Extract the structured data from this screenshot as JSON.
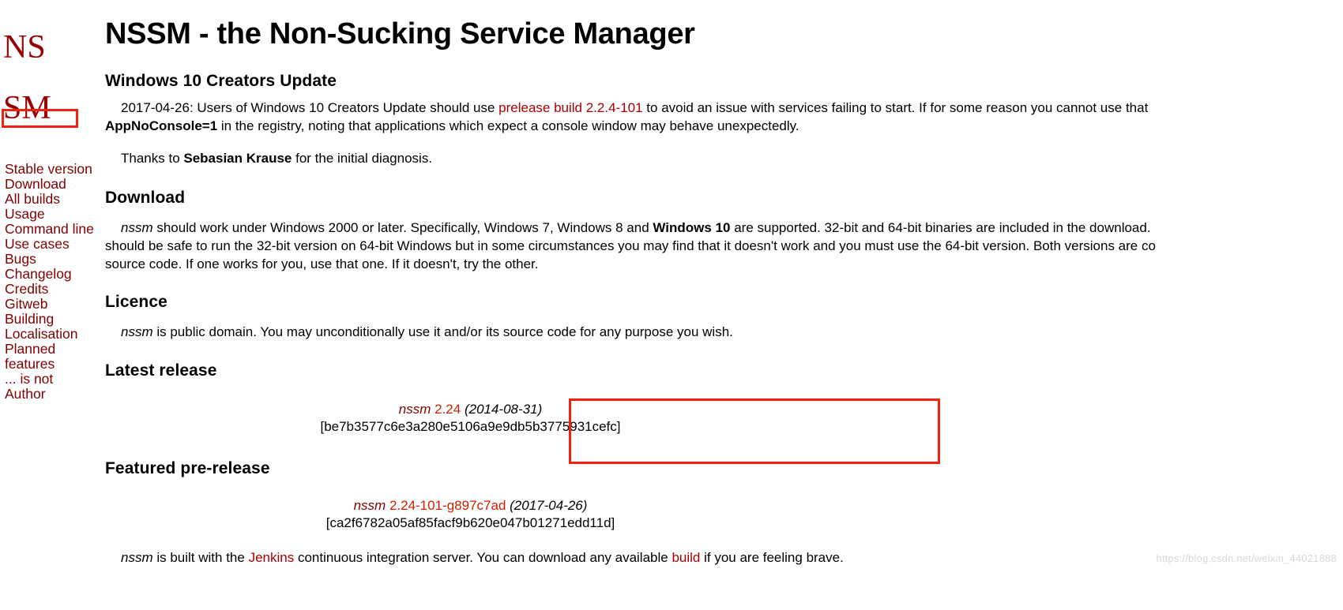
{
  "site": {
    "logo_lines": [
      "NS",
      "SM"
    ],
    "title": "NSSM - the Non-Sucking Service Manager"
  },
  "sidebar": {
    "items": [
      {
        "label": "Stable version"
      },
      {
        "label": "Download"
      },
      {
        "label": "All builds"
      },
      {
        "label": "Usage"
      },
      {
        "label": "Command line"
      },
      {
        "label": "Use cases"
      },
      {
        "label": "Bugs"
      },
      {
        "label": "Changelog"
      },
      {
        "label": "Credits"
      },
      {
        "label": "Gitweb"
      },
      {
        "label": "Building"
      },
      {
        "label": "Localisation"
      },
      {
        "label": "Planned features"
      },
      {
        "label": "... is not"
      },
      {
        "label": "Author"
      }
    ]
  },
  "sections": {
    "creators_update": {
      "heading": "Windows 10 Creators Update",
      "para1_a": "2017-04-26: Users of Windows 10 Creators Update should use ",
      "para1_link": "prelease build 2.2.4-101",
      "para1_b": " to avoid an issue with services failing to start. If for some reason you cannot use that",
      "para1_c_bold": "AppNoConsole=1",
      "para1_d": " in the registry, noting that applications which expect a console window may behave unexpectedly.",
      "para2_a": "Thanks to ",
      "para2_bold": "Sebasian Krause",
      "para2_b": " for the initial diagnosis."
    },
    "download": {
      "heading": "Download",
      "para_a_italic": "nssm",
      "para_a": " should work under Windows 2000 or later. Specifically, Windows 7, Windows 8 and ",
      "para_bold": "Windows 10",
      "para_b": " are supported. 32-bit and 64-bit binaries are included in the download.",
      "para_line2": "should be safe to run the 32-bit version on 64-bit Windows but in some circumstances you may find that it doesn't work and you must use the 64-bit version. Both versions are co",
      "para_line3": "source code. If one works for you, use that one. If it doesn't, try the other."
    },
    "licence": {
      "heading": "Licence",
      "para_italic": "nssm",
      "para": " is public domain. You may unconditionally use it and/or its source code for any purpose you wish."
    },
    "latest_release": {
      "heading": "Latest release",
      "name": "nssm",
      "version": "2.24",
      "date": "(2014-08-31)",
      "hash": "[be7b3577c6e3a280e5106a9e9db5b3775931cefc]"
    },
    "featured_prerelease": {
      "heading": "Featured pre-release",
      "name": "nssm",
      "version": "2.24-101-g897c7ad",
      "date": "(2017-04-26)",
      "hash": "[ca2f6782a05af85facf9b620e047b01271edd11d]",
      "footer_a_italic": "nssm",
      "footer_a": " is built with the ",
      "footer_link1": "Jenkins",
      "footer_b": " continuous integration server. You can download any available ",
      "footer_link2": "build",
      "footer_c": " if you are feeling brave."
    }
  },
  "annotations": {
    "download_box": "",
    "latest_release_box": "",
    "color": "#f22211"
  },
  "watermark": {
    "text": "https://blog.csdn.net/weixin_44021888"
  }
}
